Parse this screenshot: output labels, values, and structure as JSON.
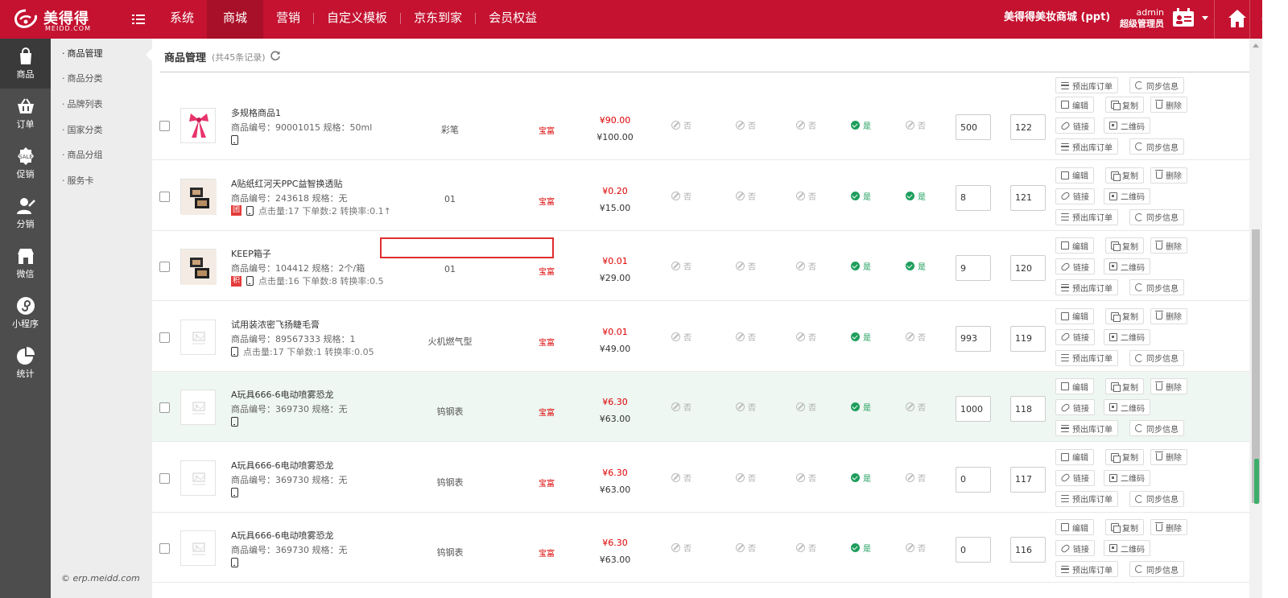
{
  "brand": {
    "name": "美得得",
    "sub": "MEIDD.COM"
  },
  "nav": {
    "items": [
      "系统",
      "商城",
      "营销",
      "自定义模板",
      "京东到家",
      "会员权益"
    ],
    "active_index": 1
  },
  "header": {
    "shop": "美得得美妆商城 (ppt)",
    "user": "admin",
    "role": "超级管理员"
  },
  "sidebar": {
    "items": [
      "商品",
      "订单",
      "促销",
      "分销",
      "微信",
      "小程序",
      "统计"
    ],
    "active_index": 0
  },
  "subnav": {
    "items": [
      "商品管理",
      "商品分类",
      "品牌列表",
      "国家分类",
      "商品分组",
      "服务卡"
    ],
    "active_index": 0
  },
  "copyright": "© erp.meidd.com",
  "page": {
    "title": "商品管理",
    "count": "(共45条记录)"
  },
  "ops": {
    "edit": "编辑",
    "copy": "复制",
    "delete": "删除",
    "link": "链接",
    "qrcode": "二维码",
    "pre_order": "预出库订单",
    "sync": "同步信息"
  },
  "flags": {
    "yes": "是",
    "no": "否"
  },
  "products": [
    {
      "name": "多规格商品1",
      "code": "商品编号：90001015 规格：50ml",
      "meta": "",
      "badge": "",
      "brand": "彩笔",
      "source": "宝富",
      "price": "¥90.00",
      "market_price": "¥100.00",
      "flags": [
        "否",
        "否",
        "否",
        "是",
        "否"
      ],
      "stock": "500",
      "sort": "122",
      "thumb": "gift"
    },
    {
      "name": "A贴纸红河天PPC益智换透贴",
      "code": "商品编号：243618 规格：无",
      "meta": "点击量:17 下单数:2 转换率:0.1↑",
      "badge": "团",
      "brand": "01",
      "source": "宝富",
      "price": "¥0.20",
      "market_price": "¥15.00",
      "flags": [
        "否",
        "否",
        "否",
        "是",
        "是"
      ],
      "stock": "8",
      "sort": "121",
      "thumb": "compact"
    },
    {
      "name": "KEEP箱子",
      "code": "商品编号：104412 规格：2个/箱",
      "meta": "点击量:16 下单数:8 转换率:0.5",
      "badge": "积",
      "brand": "01",
      "source": "宝富",
      "price": "¥0.01",
      "market_price": "¥29.00",
      "flags": [
        "否",
        "否",
        "否",
        "是",
        "是"
      ],
      "stock": "9",
      "sort": "120",
      "thumb": "compact"
    },
    {
      "name": "试用装浓密飞扬睫毛膏",
      "code": "商品编号：89567333 规格：1",
      "meta": "点击量:17 下单数:1 转换率:0.05",
      "badge": "",
      "brand": "火机燃气型",
      "source": "宝富",
      "price": "¥0.01",
      "market_price": "¥49.00",
      "flags": [
        "否",
        "否",
        "否",
        "是",
        "否"
      ],
      "stock": "993",
      "sort": "119",
      "thumb": "blank"
    },
    {
      "name": "A玩具666-6电动喷雾恐龙",
      "code": "商品编号：369730 规格：无",
      "meta": "",
      "badge": "",
      "brand": "钨钢表",
      "source": "宝富",
      "price": "¥6.30",
      "market_price": "¥63.00",
      "flags": [
        "否",
        "否",
        "否",
        "是",
        "否"
      ],
      "stock": "1000",
      "sort": "118",
      "thumb": "blank"
    },
    {
      "name": "A玩具666-6电动喷雾恐龙",
      "code": "商品编号：369730 规格：无",
      "meta": "",
      "badge": "",
      "brand": "钨钢表",
      "source": "宝富",
      "price": "¥6.30",
      "market_price": "¥63.00",
      "flags": [
        "否",
        "否",
        "否",
        "是",
        "否"
      ],
      "stock": "0",
      "sort": "117",
      "thumb": "blank"
    },
    {
      "name": "A玩具666-6电动喷雾恐龙",
      "code": "商品编号：369730 规格：无",
      "meta": "",
      "badge": "",
      "brand": "钨钢表",
      "source": "宝富",
      "price": "¥6.30",
      "market_price": "¥63.00",
      "flags": [
        "否",
        "否",
        "否",
        "是",
        "否"
      ],
      "stock": "0",
      "sort": "116",
      "thumb": "blank"
    }
  ]
}
